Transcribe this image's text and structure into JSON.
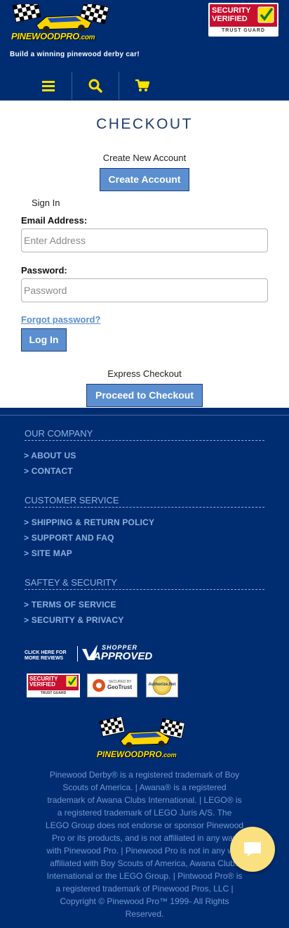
{
  "header": {
    "logo_text": "PINEWOODPRO",
    "logo_suffix": ".com",
    "tagline": "Build a winning pinewood derby car!",
    "security_badge": {
      "line1": "SECURITY",
      "line2": "VERIFIED",
      "bottom": "TRUST GUARD"
    },
    "nav": {
      "icons": [
        "menu-icon",
        "search-icon",
        "cart-icon"
      ]
    },
    "accent_color": "#ffe100",
    "background_color": "#002d72"
  },
  "main": {
    "title": "CHECKOUT",
    "create_section_label": "Create New Account",
    "create_button": "Create Account",
    "signin_label": "Sign In",
    "email_label": "Email Address:",
    "email_placeholder": "Enter Address",
    "email_value": "",
    "password_label": "Password:",
    "password_placeholder": "Password",
    "password_value": "",
    "forgot_link": "Forgot password?",
    "login_button": "Log In",
    "express_label": "Express Checkout",
    "proceed_button": "Proceed to Checkout",
    "button_color": "#5b8fd0"
  },
  "footer": {
    "sections": [
      {
        "heading": "OUR COMPANY",
        "links": [
          "> ABOUT US",
          "> CONTACT"
        ]
      },
      {
        "heading": "CUSTOMER SERVICE",
        "links": [
          "> SHIPPING & RETURN POLICY",
          "> SUPPORT AND FAQ",
          "> SITE MAP"
        ]
      },
      {
        "heading": "SAFTEY & SECURITY",
        "links": [
          "> TERMS OF SERVICE",
          "> SECURITY & PRIVACY"
        ]
      }
    ],
    "shopper_approved": {
      "small1": "CLICK HERE FOR",
      "small2": "MORE REVIEWS",
      "top": "SHOPPER",
      "name": "APPROVED"
    },
    "badges": {
      "security": {
        "line1": "SECURITY",
        "line2": "VERIFIED",
        "bottom": "TRUST GUARD"
      },
      "geotrust": {
        "line1": "SECURED BY",
        "line2": "GeoTrust"
      },
      "authorize": "Authorize.Net"
    },
    "logo_text": "PINEWOODPRO",
    "logo_suffix": ".com",
    "legal": "Pinewood Derby® is a registered trademark of Boy Scouts of America. | Awana® is a registered trademark of Awana Clubs International. | LEGO® is a registered trademark of LEGO Juris A/S. The LEGO Group does not endorse or sponsor Pinewood Pro or its products, and is not affiliated in any way with Pinewood Pro. | Pinewood Pro is not in any way affiliated with Boy Scouts of America, Awana Clubs International or the LEGO Group. | Pintwood Pro® is a registered trademark of Pinewood Pros, LLC | Copyright © Pinewood Pro™ 1999- All Rights Reserved."
  },
  "chat": {
    "icon": "chat-bubble-icon"
  }
}
